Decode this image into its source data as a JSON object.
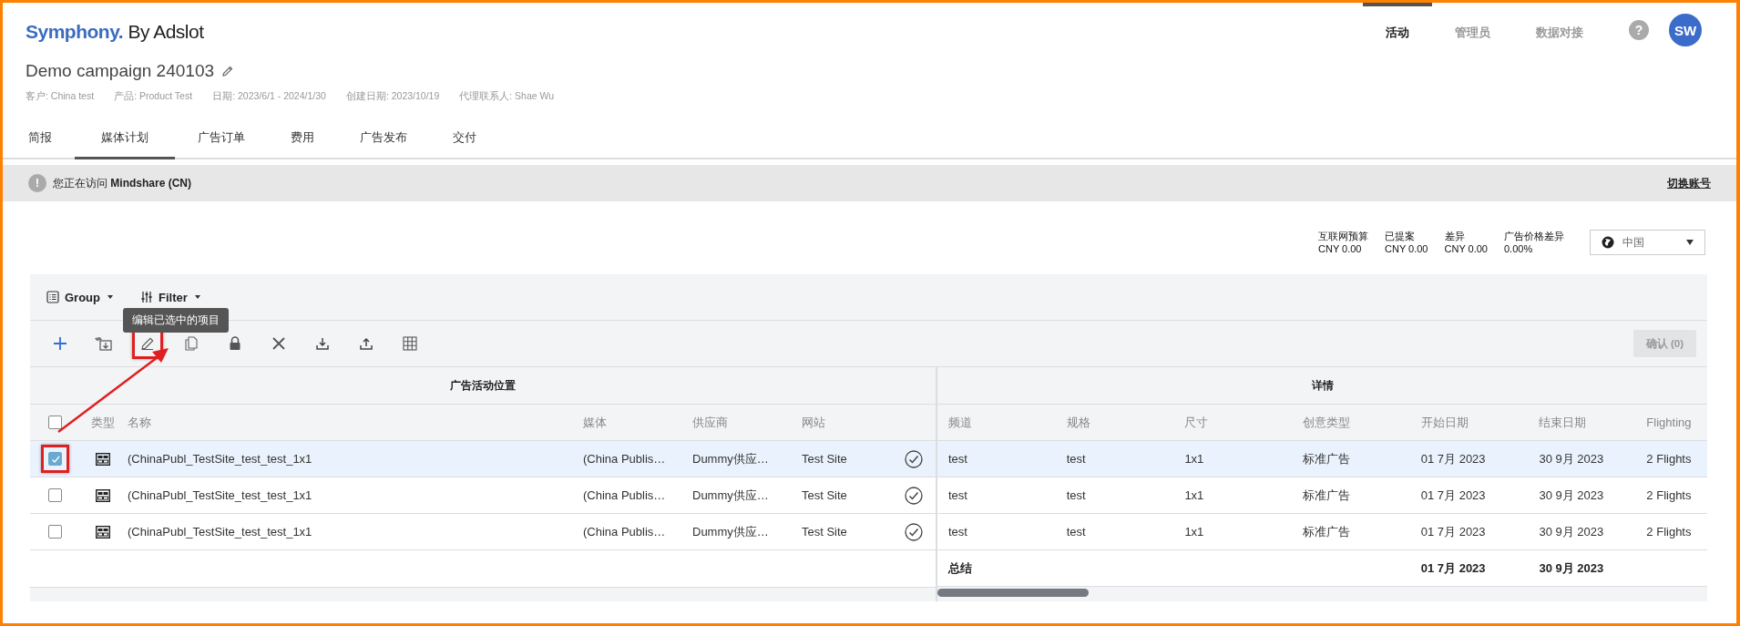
{
  "header": {
    "logo_brand": "Symphony.",
    "logo_suffix": "By Adslot",
    "nav": [
      {
        "label": "活动",
        "selected": true
      },
      {
        "label": "管理员",
        "selected": false
      },
      {
        "label": "数据对接",
        "selected": false
      }
    ],
    "help": "?",
    "avatar": "SW"
  },
  "campaign": {
    "title": "Demo campaign 240103",
    "meta": [
      "客户: China test",
      "产品: Product Test",
      "日期: 2023/6/1 - 2024/1/30",
      "创建日期: 2023/10/19",
      "代理联系人: Shae Wu"
    ]
  },
  "tabs": [
    {
      "label": "简报",
      "selected": false
    },
    {
      "label": "媒体计划",
      "selected": true
    },
    {
      "label": "广告订单",
      "selected": false
    },
    {
      "label": "费用",
      "selected": false
    },
    {
      "label": "广告发布",
      "selected": false
    },
    {
      "label": "交付",
      "selected": false
    }
  ],
  "notice": {
    "icon": "!",
    "text": "您正在访问 **Mindshare (CN)**",
    "link": "切换账号"
  },
  "summary": [
    {
      "label": "互联网预算",
      "value": "CNY 0.00"
    },
    {
      "label": "已提案",
      "value": "CNY 0.00"
    },
    {
      "label": "差异",
      "value": "CNY 0.00"
    },
    {
      "label": "广告价格差异",
      "value": "0.00%"
    }
  ],
  "region_select": {
    "value": "中国"
  },
  "grid": {
    "group_label": "Group",
    "filter_label": "Filter",
    "tooltip": "编辑已选中的项目",
    "toolbar": [
      {
        "kind": "add",
        "highlighted": false
      },
      {
        "kind": "move",
        "highlighted": false
      },
      {
        "kind": "edit",
        "highlighted": true
      },
      {
        "kind": "duplicate",
        "highlighted": false
      },
      {
        "kind": "lock",
        "highlighted": false
      },
      {
        "kind": "delete",
        "highlighted": false
      },
      {
        "kind": "download",
        "highlighted": false
      },
      {
        "kind": "upload",
        "highlighted": false
      },
      {
        "kind": "columns",
        "highlighted": false
      }
    ],
    "confirm_button": {
      "label": "确认 (0)",
      "disabled": true
    },
    "left_header": "广告活动位置",
    "right_header": "详情",
    "all_checked": false,
    "left_columns": [
      "类型",
      "名称",
      "媒体",
      "供应商",
      "网站"
    ],
    "right_columns": [
      "频道",
      "规格",
      "尺寸",
      "创意类型",
      "开始日期",
      "结束日期",
      "Flighting"
    ],
    "rows": [
      {
        "selected": true,
        "highlighted": true,
        "confirmed": true,
        "name": "(ChinaPubl_TestSite_test_test_1x1",
        "media": "(China Publis…",
        "supplier": "Dummy供应…",
        "site": "Test Site",
        "cells": [
          "test",
          "test",
          "1x1",
          "标准广告",
          "01 7月 2023",
          "30 9月 2023",
          "2 Flights"
        ]
      },
      {
        "selected": false,
        "highlighted": false,
        "confirmed": true,
        "name": "(ChinaPubl_TestSite_test_test_1x1",
        "media": "(China Publis…",
        "supplier": "Dummy供应…",
        "site": "Test Site",
        "cells": [
          "test",
          "test",
          "1x1",
          "标准广告",
          "01 7月 2023",
          "30 9月 2023",
          "2 Flights"
        ]
      },
      {
        "selected": false,
        "highlighted": false,
        "confirmed": true,
        "name": "(ChinaPubl_TestSite_test_test_1x1",
        "media": "(China Publis…",
        "supplier": "Dummy供应…",
        "site": "Test Site",
        "cells": [
          "test",
          "test",
          "1x1",
          "标准广告",
          "01 7月 2023",
          "30 9月 2023",
          "2 Flights"
        ]
      }
    ],
    "total": {
      "label": "总结",
      "start": "01 7月 2023",
      "end": "30 9月 2023"
    }
  }
}
